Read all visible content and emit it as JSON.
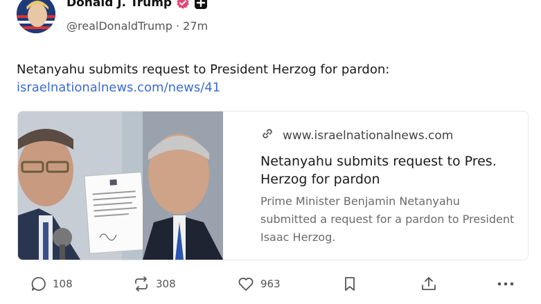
{
  "author": {
    "display_name": "Donald J. Trump",
    "handle": "@realDonaldTrump",
    "separator": "·",
    "time_ago": "27m"
  },
  "post": {
    "text": "Netanyahu submits request to President Herzog for pardon:",
    "link_text": "israelnationalnews.com/news/41"
  },
  "link_card": {
    "domain": "www.israelnationalnews.com",
    "title": "Netanyahu submits request to Pres. Herzog for pardon",
    "description": "Prime Minister Benjamin Netanyahu submitted a request for a pardon to President Isaac Herzog."
  },
  "actions": {
    "replies": "108",
    "reposts": "308",
    "likes": "963"
  },
  "colors": {
    "link": "#3b6ad8",
    "verified_badge": "#e3477a",
    "muted_text": "#6b6b6b"
  },
  "icons": [
    "verified-badge-icon",
    "plus-badge-icon",
    "link-icon",
    "reply-icon",
    "repost-icon",
    "like-icon",
    "bookmark-icon",
    "share-icon",
    "more-icon"
  ]
}
